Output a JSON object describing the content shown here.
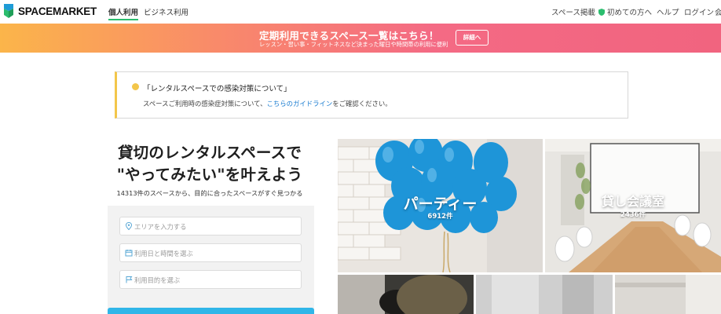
{
  "header": {
    "logo_text": "SPACEMARKET",
    "tabs": [
      {
        "label": "個人利用"
      },
      {
        "label": "ビジネス利用"
      }
    ],
    "links": {
      "list_space": "スペース掲載",
      "first_time": "初めての方へ",
      "help": "ヘルプ",
      "login": "ログイン",
      "signup": "会員"
    }
  },
  "promo": {
    "title": "定期利用できるスペース一覧はこちら！",
    "subtitle": "レッスン・習い事・フィットネスなど決まった曜日や時間帯の利用に便利",
    "button": "詳細へ"
  },
  "notice": {
    "title": "「レンタルスペースでの感染対策について」",
    "body_before": "スペースご利用時の感染症対策について、",
    "link": "こちらのガイドライン",
    "body_after": "をご確認ください。"
  },
  "hero": {
    "headline_line1": "貸切のレンタルスペースで",
    "headline_line2": "\"やってみたい\"を叶えよう",
    "subtext": "14313件のスペースから、目的に合ったスペースがすぐ見つかる"
  },
  "search": {
    "area_placeholder": "エリアを入力する",
    "date_placeholder": "利用日と時間を選ぶ",
    "purpose_placeholder": "利用目的を選ぶ"
  },
  "categories": [
    {
      "label": "パーティー",
      "count": "6912件"
    },
    {
      "label": "貸し会議室",
      "count": "2436件"
    }
  ],
  "colors": {
    "brand_green": "#2bbd6e",
    "promo_orange": "#fbb54a",
    "promo_pink": "#f1647f",
    "notice_yellow": "#f3c64a",
    "link_blue": "#1b7dd1",
    "search_button": "#30b6e8"
  }
}
